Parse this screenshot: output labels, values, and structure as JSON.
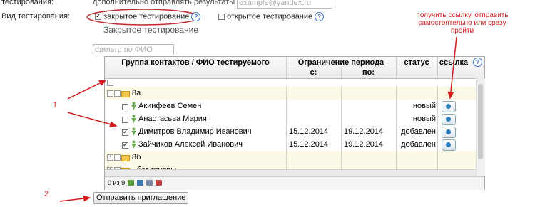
{
  "top": {
    "label": "тестирования:",
    "hint_prefix": "дополнительно отправлять результаты на:",
    "email_placeholder": "example@yandex.ru"
  },
  "mode": {
    "label": "Вид тестирования:",
    "closed": "закрытое тестирование",
    "open": "открытое тестирование",
    "section_title": "Закрытое тестирование"
  },
  "filter_placeholder": "фильтр по ФИО",
  "annotation_right": [
    "получить ссылку, отправить",
    "самостоятельно или сразу",
    "пройти"
  ],
  "columns": {
    "group": "Группа контактов / ФИО тестируемого",
    "period": "Ограничение периода",
    "from": "с:",
    "to": "по:",
    "status": "статус",
    "link": "ссылка"
  },
  "rows": [
    {
      "type": "group",
      "name": "8а",
      "expanded": true
    },
    {
      "type": "person",
      "name": "Акинфеев Семен",
      "checked": false,
      "from": "",
      "to": "",
      "status": "новый"
    },
    {
      "type": "person",
      "name": "Анастасьва Мария",
      "checked": false,
      "from": "",
      "to": "",
      "status": "новый"
    },
    {
      "type": "person",
      "name": "Димитров Владимир Иванович",
      "checked": true,
      "from": "15.12.2014",
      "to": "19.12.2014",
      "status": "добавлен"
    },
    {
      "type": "person",
      "name": "Зайчиков Алексей Иванович",
      "checked": true,
      "from": "15.12.2014",
      "to": "19.12.2014",
      "status": "добавлен"
    },
    {
      "type": "group",
      "name": "8б",
      "expanded": false
    },
    {
      "type": "group",
      "name": "- без группы -",
      "expanded": false
    }
  ],
  "footer": {
    "count": "0 из 9"
  },
  "markers": {
    "one": "1",
    "two": "2"
  },
  "send_button": "Отправить приглашение",
  "colors": {
    "accent_red": "#d21d1d",
    "annotation_ellipse": "#c0282d",
    "group_row": "#fdf9e7"
  }
}
